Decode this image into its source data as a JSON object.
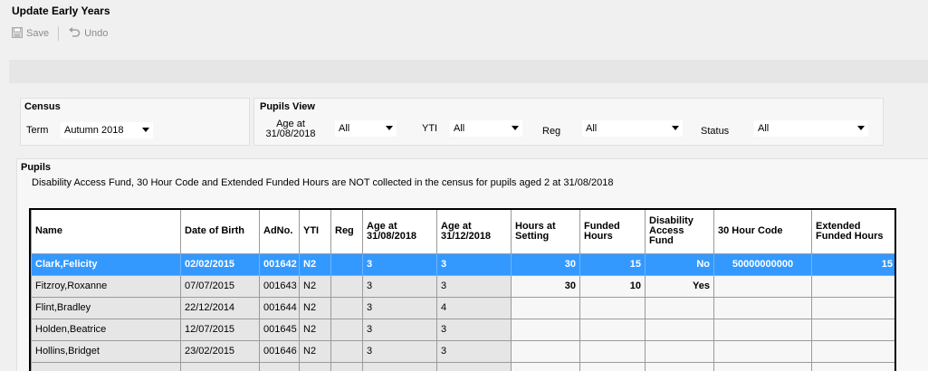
{
  "window": {
    "title": "Update Early Years"
  },
  "toolbar": {
    "save_label": "Save",
    "undo_label": "Undo"
  },
  "census": {
    "title": "Census",
    "term_label": "Term",
    "term_value": "Autumn 2018"
  },
  "pupils_view": {
    "title": "Pupils View",
    "age_label_line1": "Age at",
    "age_label_line2": "31/08/2018",
    "age_value": "All",
    "yti_label": "YTI",
    "yti_value": "All",
    "reg_label": "Reg",
    "reg_value": "All",
    "status_label": "Status",
    "status_value": "All"
  },
  "pupils": {
    "title": "Pupils",
    "note": "Disability Access Fund, 30 Hour Code and Extended Funded Hours are NOT collected in the census for pupils aged 2 at 31/08/2018",
    "columns": [
      "Name",
      "Date of Birth",
      "AdNo.",
      "YTI",
      "Reg",
      "Age at 31/08/2018",
      "Age at 31/12/2018",
      "Hours at Setting",
      "Funded Hours",
      "Disability Access Fund",
      "30 Hour Code",
      "Extended Funded Hours"
    ],
    "rows": [
      [
        "Clark,Felicity",
        "02/02/2015",
        "001642",
        "N2",
        "",
        "3",
        "3",
        "30",
        "15",
        "No",
        "50000000000",
        "15"
      ],
      [
        "Fitzroy,Roxanne",
        "07/07/2015",
        "001643",
        "N2",
        "",
        "3",
        "3",
        "30",
        "10",
        "Yes",
        "",
        ""
      ],
      [
        "Flint,Bradley",
        "22/12/2014",
        "001644",
        "N2",
        "",
        "3",
        "4",
        "",
        "",
        "",
        "",
        ""
      ],
      [
        "Holden,Beatrice",
        "12/07/2015",
        "001645",
        "N2",
        "",
        "3",
        "3",
        "",
        "",
        "",
        "",
        ""
      ],
      [
        "Hollins,Bridget",
        "23/02/2015",
        "001646",
        "N2",
        "",
        "3",
        "3",
        "",
        "",
        "",
        "",
        ""
      ]
    ]
  },
  "colors": {
    "selection": "#3399ff",
    "readonly_cell": "#e6e6e6"
  }
}
